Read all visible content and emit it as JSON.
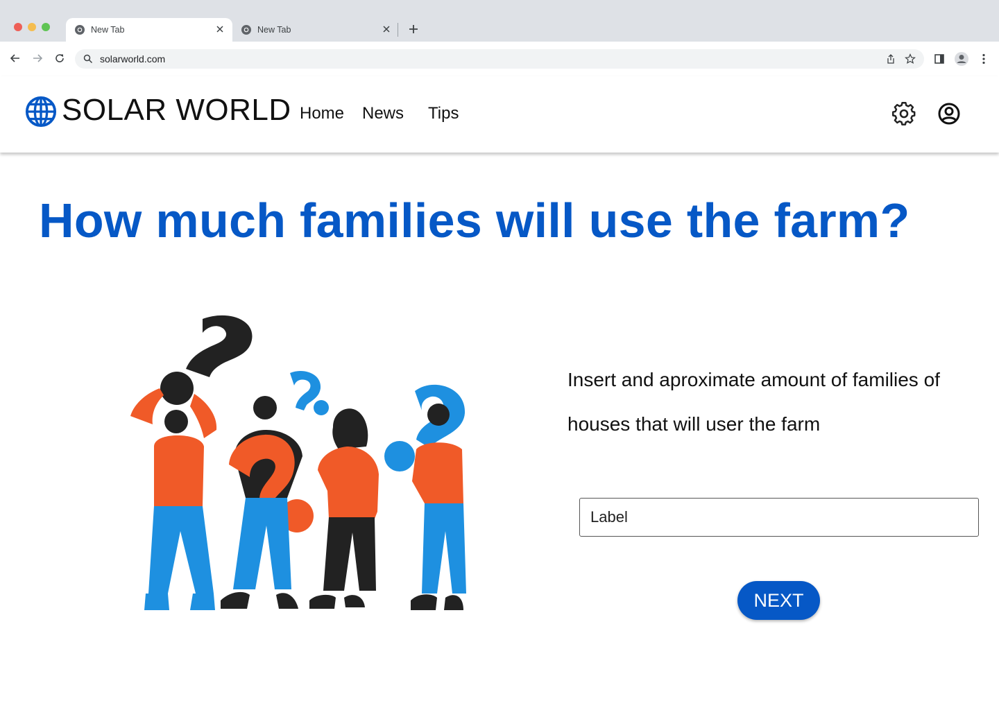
{
  "browser": {
    "tabs": [
      {
        "title": "New Tab",
        "active": true
      },
      {
        "title": "New Tab",
        "active": false
      }
    ],
    "url": "solarworld.com"
  },
  "site": {
    "title": "SOLAR WORLD",
    "nav": [
      {
        "label": "Home"
      },
      {
        "label": "News"
      },
      {
        "label": "Tips"
      }
    ],
    "icons": [
      "globe-icon",
      "gear-icon",
      "account-icon"
    ]
  },
  "main": {
    "question": "How much families will use the farm?",
    "prompt": "Insert and aproximate amount of families of houses that will user the farm",
    "input": {
      "value": "Label",
      "placeholder": "Label"
    },
    "next_label": "NEXT"
  },
  "colors": {
    "accent": "#0658c6",
    "illustration_orange": "#f05a28",
    "illustration_blue": "#1e90e0",
    "illustration_dark": "#222222"
  }
}
